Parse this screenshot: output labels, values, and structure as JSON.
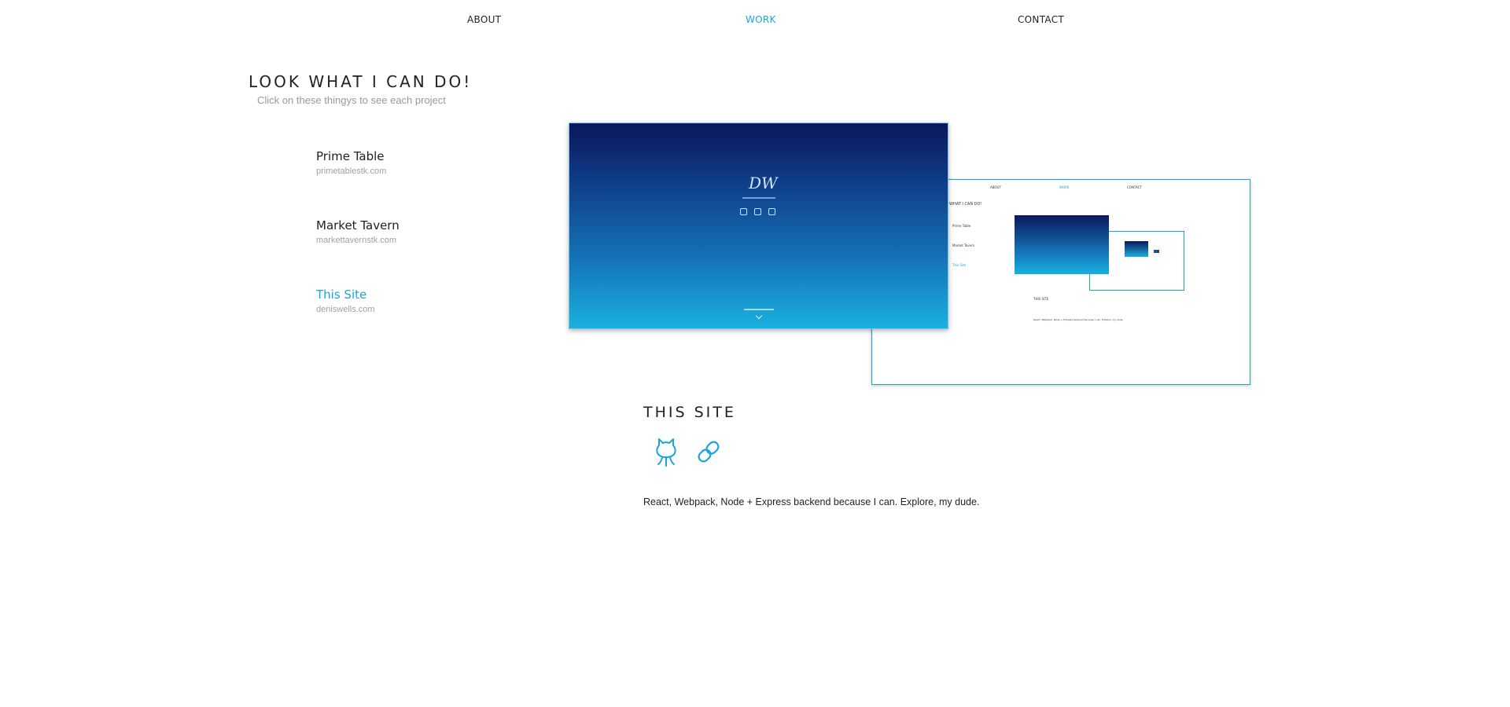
{
  "nav": {
    "about": "ABOUT",
    "work": "WORK",
    "contact": "CONTACT"
  },
  "hero": {
    "title": "LOOK WHAT I CAN DO!",
    "subtitle": "Click on these thingys to see each project"
  },
  "projects": [
    {
      "name": "Prime Table",
      "url": "primetablestk.com"
    },
    {
      "name": "Market Tavern",
      "url": "markettavernstk.com"
    },
    {
      "name": "This Site",
      "url": "deniswells.com"
    }
  ],
  "preview": {
    "logo": "DW",
    "mini_nav": {
      "about": "ABOUT",
      "work": "WORK",
      "contact": "CONTACT"
    },
    "mini_title": "WHAT I CAN DO!",
    "mini_projects": [
      "Prime Table",
      "Market Tavern",
      "This Site"
    ],
    "mini_section": "THIS SITE",
    "mini_desc": "React, Webpack, Node + Express backend because I can. Explore, my dude."
  },
  "detail": {
    "title": "THIS SITE",
    "github_icon": "github-icon",
    "link_icon": "link-icon",
    "description": "React, Webpack, Node + Express backend because I can. Explore, my dude."
  },
  "colors": {
    "accent": "#1aa6d6",
    "text": "#222222",
    "muted": "#9a9a9a"
  }
}
